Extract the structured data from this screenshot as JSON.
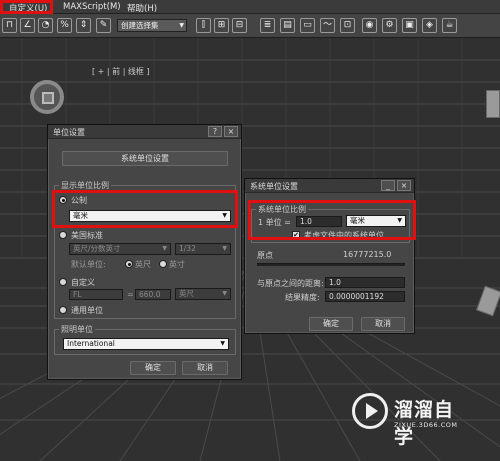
{
  "menu": {
    "items": [
      "自定义(U)",
      "MAXScript(M)",
      "帮助(H)"
    ]
  },
  "toolbar": {
    "selection_set": "创建选择集",
    "icons": [
      "snap-icon",
      "angle-snap-icon",
      "percent-snap-icon",
      "spinner-snap-icon",
      "edit-named-selection-icon",
      "mirror-icon",
      "align-icon",
      "layer-icon",
      "ribbon-icon",
      "curve-editor-icon",
      "schematic-view-icon",
      "material-editor-icon",
      "render-setup-icon",
      "rendered-frame-icon",
      "render-icon",
      "teapot-icon"
    ]
  },
  "viewport": {
    "label": "[ + | 前 | 线框 ]"
  },
  "units_dialog": {
    "title": "单位设置",
    "help": "?",
    "close": "×",
    "system_units_button": "系统单位设置",
    "display_group": "显示单位比例",
    "metric_label": "公制",
    "metric_value": "毫米",
    "us_label": "美国标准",
    "us_value": "英尺/分数英寸",
    "us_fraction": "1/32",
    "default_unit_label": "默认单位:",
    "feet_label": "英尺",
    "inches_label": "英寸",
    "custom_label": "自定义",
    "custom_name": "FL",
    "custom_eq": "=",
    "custom_value": "660.0",
    "custom_unit": "英尺",
    "generic_label": "通用单位",
    "lighting_group": "照明单位",
    "lighting_value": "International",
    "ok": "确定",
    "cancel": "取消"
  },
  "system_dialog": {
    "title": "系统单位设置",
    "minimize": "_",
    "close": "×",
    "scale_group": "系统单位比例",
    "unit_label": "1 单位 =",
    "unit_value": "1.0",
    "unit_type": "毫米",
    "respect_files_label": "考虑文件中的系统单位",
    "origin_label": "原点",
    "origin_value": "16777215.0",
    "distance_label": "与原点之间的距离:",
    "distance_value": "1.0",
    "precision_label": "结果精度:",
    "precision_value": "0.0000001192",
    "ok": "确定",
    "cancel": "取消"
  },
  "watermark": {
    "name": "溜溜自学",
    "url": "ZIXUE.3D66.COM"
  },
  "colors": {
    "highlight": "#e01010",
    "dialog_bg": "#464646",
    "viewport_bg": "#303030"
  }
}
